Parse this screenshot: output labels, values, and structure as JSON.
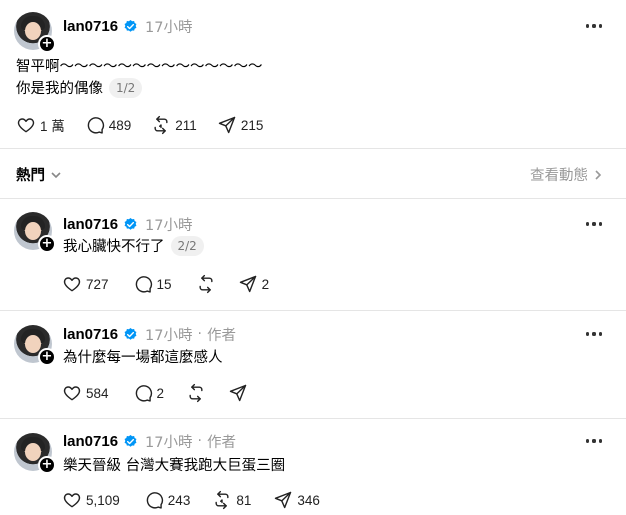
{
  "posts": [
    {
      "username": "lan0716",
      "time": "17小時",
      "author_tag": "",
      "text_lines": [
        "智平啊～～～～～～～～～～～～～～",
        "你是我的偶像"
      ],
      "pager": "1/2",
      "likes": "1 萬",
      "comments": "489",
      "reposts": "211",
      "shares": "215"
    },
    {
      "username": "lan0716",
      "time": "17小時",
      "author_tag": "",
      "text_lines": [
        "我心臟快不行了"
      ],
      "pager": "2/2",
      "likes": "727",
      "comments": "15",
      "reposts": "",
      "shares": "2"
    },
    {
      "username": "lan0716",
      "time": "17小時",
      "author_tag": "作者",
      "text_lines": [
        "為什麼每一場都這麼感人"
      ],
      "pager": "",
      "likes": "584",
      "comments": "2",
      "reposts": "",
      "shares": ""
    },
    {
      "username": "lan0716",
      "time": "17小時",
      "author_tag": "作者",
      "text_lines": [
        "樂天晉級 台灣大賽我跑大巨蛋三圈"
      ],
      "pager": "",
      "likes": "5,109",
      "comments": "243",
      "reposts": "81",
      "shares": "346"
    }
  ],
  "sort_bar": {
    "label": "熱門",
    "view_activity": "查看動態"
  },
  "colors": {
    "verified": "#0095f6",
    "muted": "#999999",
    "divider": "#e5e5e5"
  },
  "icons": [
    "heart-icon",
    "comment-icon",
    "repost-icon",
    "share-icon",
    "more-icon",
    "verified-icon",
    "plus-icon",
    "chevron-down-icon",
    "chevron-right-icon"
  ]
}
